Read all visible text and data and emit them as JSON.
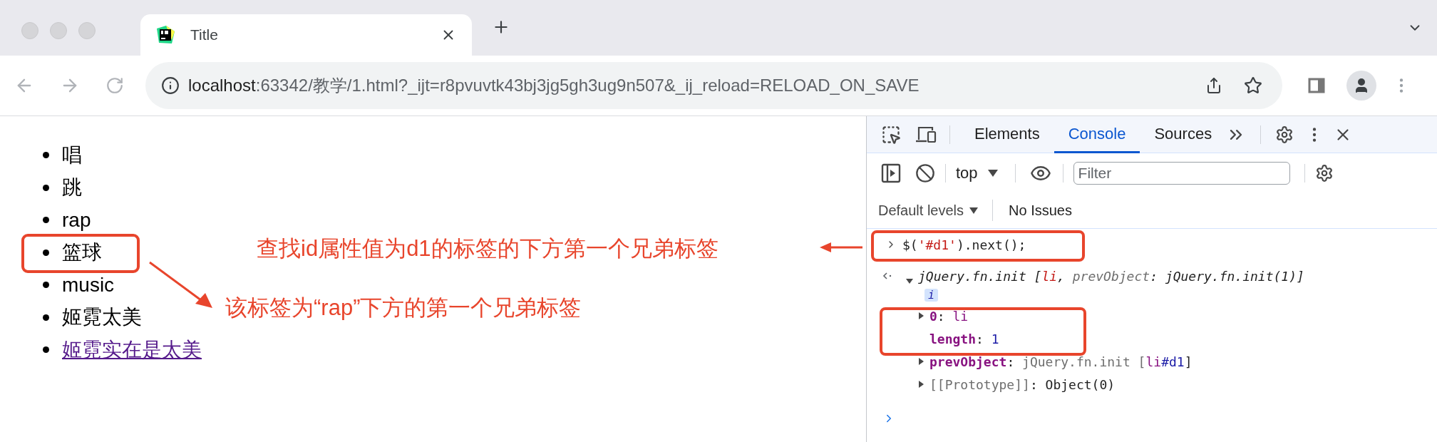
{
  "browser": {
    "tab": {
      "title": "Title"
    },
    "url": {
      "host": "localhost",
      "rest": ":63342/教学/1.html?_ijt=r8pvuvtk43bj3jg5gh3ug9n507&_ij_reload=RELOAD_ON_SAVE"
    }
  },
  "page": {
    "list": [
      {
        "text": "唱",
        "kind": "text"
      },
      {
        "text": "跳",
        "kind": "text"
      },
      {
        "text": "rap",
        "kind": "text"
      },
      {
        "text": "篮球",
        "kind": "text"
      },
      {
        "text": "music",
        "kind": "text"
      },
      {
        "text": "姬霓太美",
        "kind": "text"
      },
      {
        "text": "姬霓实在是太美",
        "kind": "link"
      }
    ]
  },
  "devtools": {
    "tabs": [
      {
        "label": "Elements",
        "selected": false
      },
      {
        "label": "Console",
        "selected": true
      },
      {
        "label": "Sources",
        "selected": false
      }
    ],
    "context": "top",
    "filter": {
      "placeholder": "Filter"
    },
    "levels": "Default levels",
    "issues": "No Issues",
    "console": [
      {
        "kind": "input",
        "tokens": [
          {
            "text": "$(",
            "kind": "plain"
          },
          {
            "text": "'#d1'",
            "kind": "string"
          },
          {
            "text": ").next();",
            "kind": "plain"
          }
        ]
      },
      {
        "kind": "result",
        "expanded": true,
        "tokens": [
          {
            "text": "jQuery.fn.init [",
            "kind": "plain"
          },
          {
            "text": "li",
            "kind": "string"
          },
          {
            "text": ", ",
            "kind": "plain"
          },
          {
            "text": "prevObject",
            "kind": "dim"
          },
          {
            "text": ": jQuery.fn.init(1)]",
            "kind": "plain"
          }
        ]
      },
      {
        "kind": "badge",
        "text": "i"
      },
      {
        "kind": "property",
        "expanded": false,
        "tokens": [
          {
            "text": "0",
            "kind": "key"
          },
          {
            "text": ": ",
            "kind": "plain"
          },
          {
            "text": "li",
            "kind": "tag"
          }
        ]
      },
      {
        "kind": "property",
        "tokens": [
          {
            "text": "length",
            "kind": "key"
          },
          {
            "text": ": ",
            "kind": "plain"
          },
          {
            "text": "1",
            "kind": "number"
          }
        ]
      },
      {
        "kind": "property",
        "expanded": false,
        "tokens": [
          {
            "text": "prevObject",
            "kind": "key"
          },
          {
            "text": ": ",
            "kind": "plain"
          },
          {
            "text": "jQuery.fn.init [",
            "kind": "dim"
          },
          {
            "text": "li",
            "kind": "tag"
          },
          {
            "text": "#d1",
            "kind": "number"
          },
          {
            "text": "]",
            "kind": "plain"
          }
        ]
      },
      {
        "kind": "property",
        "expanded": false,
        "tokens": [
          {
            "text": "[[Prototype]]",
            "kind": "dim"
          },
          {
            "text": ": ",
            "kind": "plain"
          },
          {
            "text": "Object(0)",
            "kind": "plain"
          }
        ]
      },
      {
        "kind": "prompt"
      }
    ]
  },
  "annotations": [
    {
      "text": "查找id属性值为d1的标签的下方第一个兄弟标签"
    },
    {
      "text": "该标签为“rap”下方的第一个兄弟标签"
    }
  ]
}
